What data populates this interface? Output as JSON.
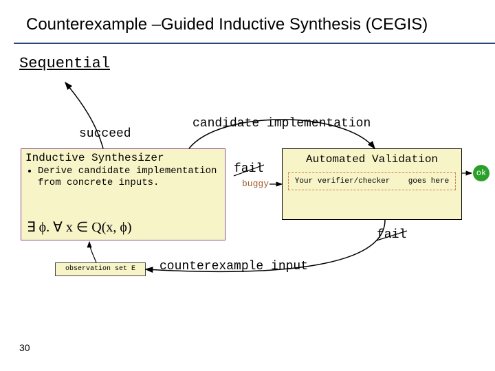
{
  "title": "Counterexample –Guided Inductive Synthesis (CEGIS)",
  "subheading": "Sequential",
  "labels": {
    "succeed": "succeed",
    "candidate_impl": "candidate implementation",
    "fail": "fail",
    "buggy": "buggy",
    "counterexample": "counterexample input",
    "observation_set": "observation set E",
    "ok": "ok"
  },
  "synth": {
    "title": "Inductive Synthesizer",
    "bullet": "Derive candidate implementation from concrete inputs.",
    "formula_parts": {
      "exists": "∃",
      "phi_dot": " ϕ. ",
      "forall": "∀",
      "x_in": " x ∈ Q(x, ϕ)"
    }
  },
  "valid": {
    "title": "Automated Validation",
    "inner_left": "Your verifier/checker",
    "inner_right": "goes here"
  },
  "page": "30"
}
